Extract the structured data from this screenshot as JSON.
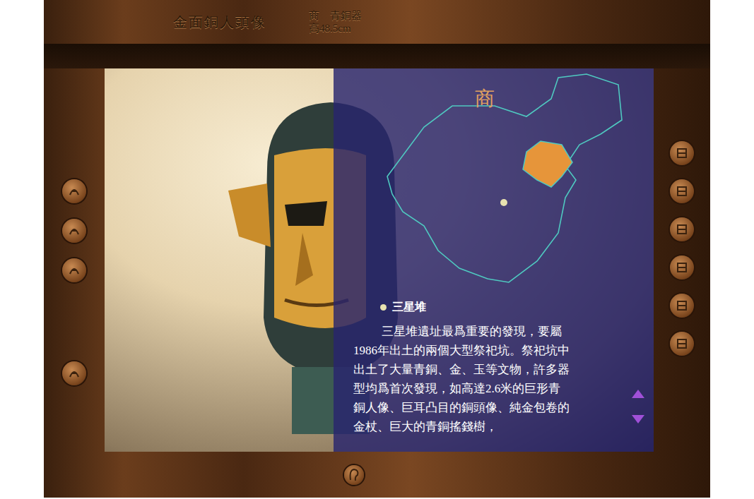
{
  "header": {
    "title": "金面銅人頭像",
    "period": "商　青銅器",
    "height": "高48.5cm"
  },
  "map": {
    "label": "商"
  },
  "site": {
    "name": "三星堆",
    "lines": [
      "三星堆遺址最爲重要的發現，要屬",
      "1986年出土的兩個大型祭祀坑。祭祀坑中",
      "出土了大量青銅、金、玉等文物，許多器",
      "型均爲首次發現，如高達2.6米的巨形青",
      "銅人像、巨耳凸目的銅頭像、純金包卷的",
      "金杖、巨大的青銅搖錢樹，"
    ]
  }
}
